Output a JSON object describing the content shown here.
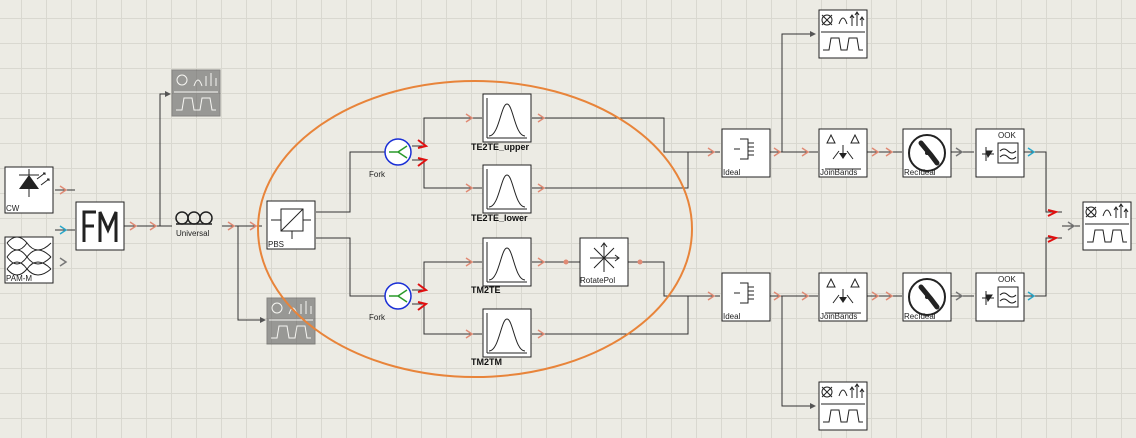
{
  "labels": {
    "cw": "CW",
    "pam": "PAM-M",
    "universal": "Universal",
    "pbs": "PBS",
    "fork_top": "Fork",
    "fork_bottom": "Fork",
    "te2te_upper": "TE2TE_upper",
    "te2te_lower": "TE2TE_lower",
    "tm2te": "TM2TE",
    "tm2tm": "TM2TM",
    "rotatepol": "RotatePol",
    "ideal_top": "Ideal",
    "ideal_bottom": "Ideal",
    "joinbands_top": "JoinBands",
    "joinbands_bottom": "JoinBands",
    "recideal_top": "RecIdeal",
    "recideal_bottom": "RecIdeal",
    "ook_top": "OOK",
    "ook_bottom": "OOK"
  },
  "colors": {
    "highlight_ellipse": "#e8843a",
    "port_optical": "#e08a74",
    "port_electrical": "#2aa7c9",
    "port_active": "#e01010",
    "wire": "#333333",
    "disabled_block": "#7d7d7d"
  },
  "icons": {
    "source": "laser-diode-icon",
    "modulator": "am-modulator-icon",
    "fiber": "fiber-coil-icon",
    "analyzer": "signal-analyzer-icon",
    "filter": "bandpass-filter-icon",
    "splitter": "polarization-splitter-icon",
    "rotator": "polarization-rotator-icon",
    "demux": "ideal-demux-icon",
    "join": "join-bands-icon",
    "receiver": "receiver-icon",
    "detector": "photodetector-icon"
  }
}
